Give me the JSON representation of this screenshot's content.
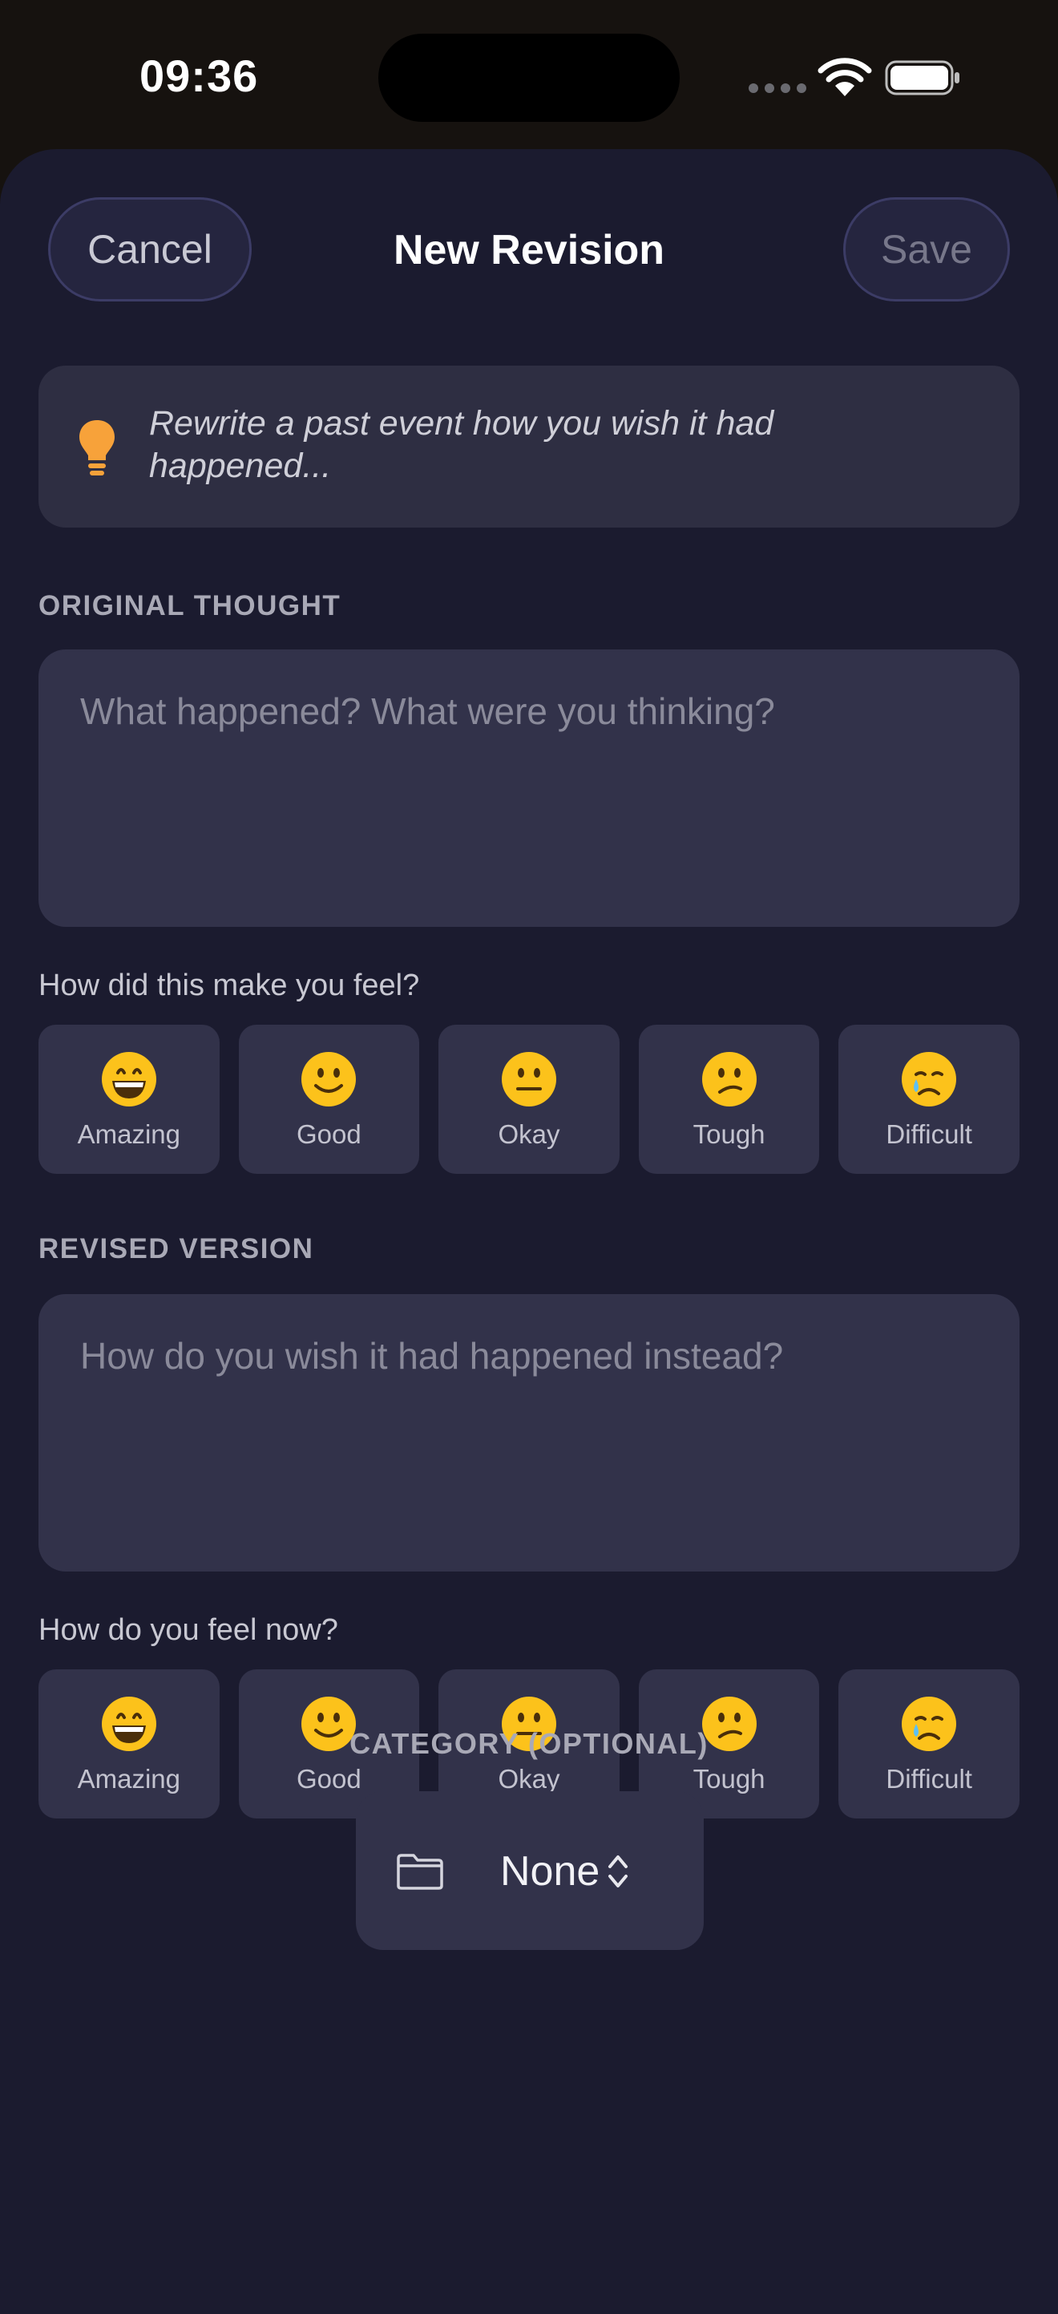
{
  "status_bar": {
    "time": "09:36"
  },
  "header": {
    "cancel_label": "Cancel",
    "title": "New Revision",
    "save_label": "Save"
  },
  "hint": {
    "icon": "lightbulb-icon",
    "text": "Rewrite a past event how you wish it had happened..."
  },
  "original": {
    "section_label": "ORIGINAL THOUGHT",
    "placeholder": "What happened? What were you thinking?",
    "feel_question": "How did this make you feel?"
  },
  "revised": {
    "section_label": "REVISED VERSION",
    "placeholder": "How do you wish it had happened instead?",
    "feel_question": "How do you feel now?"
  },
  "moods": [
    {
      "label": "Amazing",
      "icon": "grinning-face-icon"
    },
    {
      "label": "Good",
      "icon": "slightly-smiling-face-icon"
    },
    {
      "label": "Okay",
      "icon": "neutral-face-icon"
    },
    {
      "label": "Tough",
      "icon": "confused-face-icon"
    },
    {
      "label": "Difficult",
      "icon": "crying-face-icon"
    }
  ],
  "category": {
    "section_label": "CATEGORY (OPTIONAL)",
    "value": "None",
    "icon": "folder-icon"
  },
  "colors": {
    "accent_orange": "#f7a23a",
    "sheet_bg": "#1b1b2f",
    "card_bg": "#32324a"
  }
}
